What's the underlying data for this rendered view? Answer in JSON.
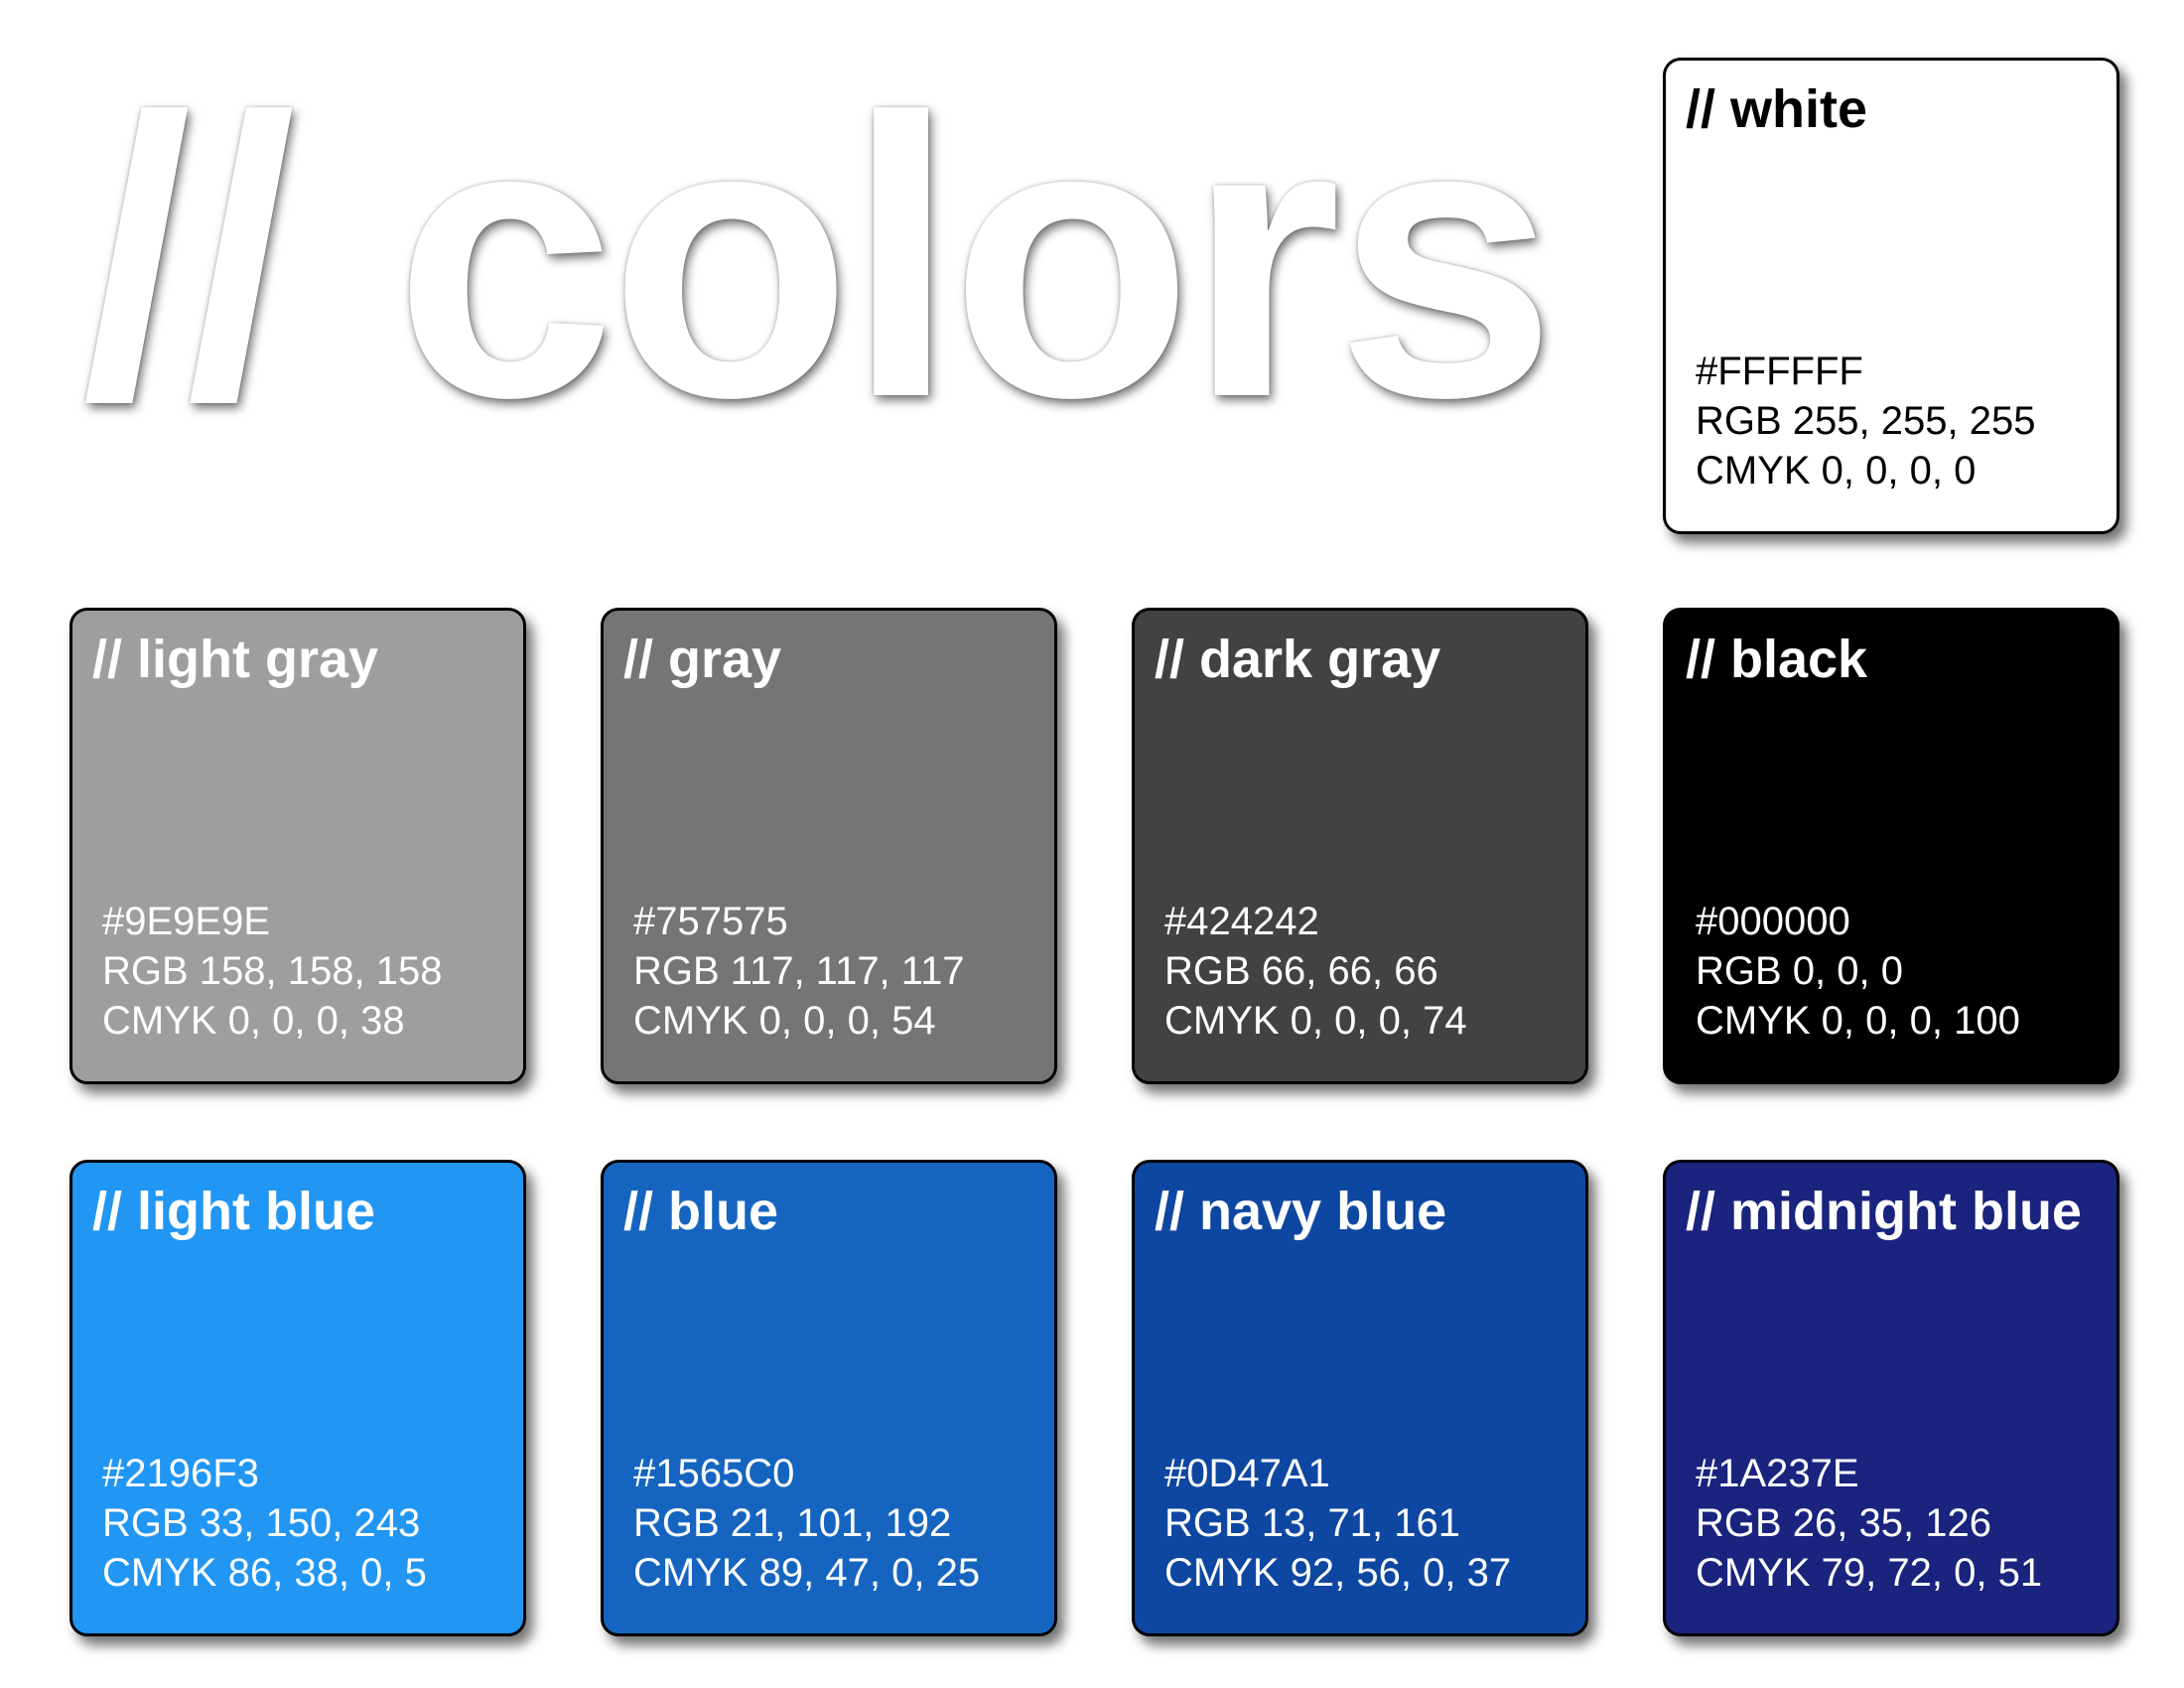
{
  "page": {
    "title": "// colors"
  },
  "swatches": [
    {
      "name": "// white",
      "hex": "#FFFFFF",
      "rgb": "RGB 255, 255, 255",
      "cmyk": "CMYK 0, 0, 0, 0",
      "fill": "#FFFFFF",
      "text_color": "#000000"
    },
    {
      "name": "// light gray",
      "hex": "#9E9E9E",
      "rgb": "RGB 158, 158, 158",
      "cmyk": "CMYK 0, 0, 0, 38",
      "fill": "#9E9E9E",
      "text_color": "#FFFFFF"
    },
    {
      "name": "// gray",
      "hex": "#757575",
      "rgb": "RGB 117, 117, 117",
      "cmyk": "CMYK 0, 0, 0, 54",
      "fill": "#757575",
      "text_color": "#FFFFFF"
    },
    {
      "name": "// dark gray",
      "hex": "#424242",
      "rgb": "RGB 66, 66, 66",
      "cmyk": "CMYK 0, 0, 0, 74",
      "fill": "#424242",
      "text_color": "#FFFFFF"
    },
    {
      "name": "// black",
      "hex": "#000000",
      "rgb": "RGB 0, 0, 0",
      "cmyk": "CMYK 0, 0, 0, 100",
      "fill": "#000000",
      "text_color": "#FFFFFF"
    },
    {
      "name": "// light blue",
      "hex": "#2196F3",
      "rgb": "RGB 33, 150, 243",
      "cmyk": "CMYK 86, 38, 0, 5",
      "fill": "#2196F3",
      "text_color": "#FFFFFF"
    },
    {
      "name": "// blue",
      "hex": "#1565C0",
      "rgb": "RGB 21, 101, 192",
      "cmyk": "CMYK 89, 47, 0, 25",
      "fill": "#1565C0",
      "text_color": "#FFFFFF"
    },
    {
      "name": "// navy blue",
      "hex": "#0D47A1",
      "rgb": "RGB 13, 71, 161",
      "cmyk": "CMYK 92, 56, 0, 37",
      "fill": "#0D47A1",
      "text_color": "#FFFFFF"
    },
    {
      "name": "// midnight blue",
      "hex": "#1A237E",
      "rgb": "RGB 26, 35, 126",
      "cmyk": "CMYK 79, 72, 0, 51",
      "fill": "#1A237E",
      "text_color": "#FFFFFF"
    }
  ]
}
